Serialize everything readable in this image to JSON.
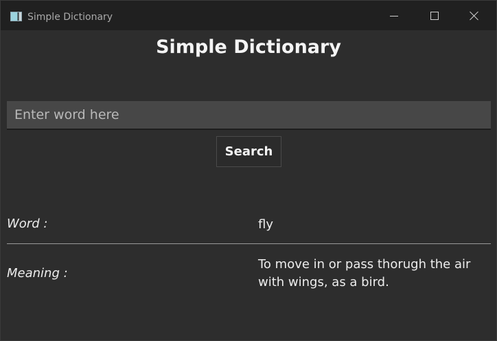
{
  "window": {
    "title": "Simple Dictionary",
    "icon": "app-window-icon",
    "controls": [
      "minimize-icon",
      "maximize-icon",
      "close-icon"
    ]
  },
  "app": {
    "heading": "Simple Dictionary"
  },
  "search": {
    "value": "",
    "placeholder": "Enter word here",
    "button_label": "Search"
  },
  "result": {
    "word_label": "Word :",
    "word_value": "fly",
    "meaning_label": "Meaning :",
    "meaning_value": "To move in or pass thorugh the air with wings, as a bird."
  },
  "colors": {
    "window_bg": "#2d2d2d",
    "titlebar_bg": "#202020",
    "input_bg": "#474747",
    "text": "#ededed"
  }
}
